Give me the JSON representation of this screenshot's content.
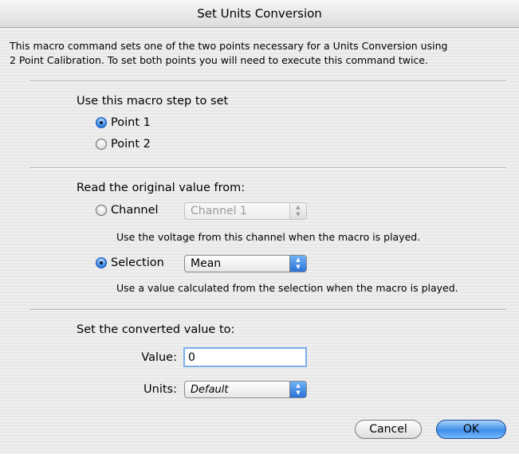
{
  "window": {
    "title": "Set Units Conversion"
  },
  "intro": {
    "line1": "This macro command sets one of the two points necessary for a Units Conversion using",
    "line2": "2 Point Calibration. To set both points you will need to execute this command twice."
  },
  "step": {
    "heading": "Use this macro step to set",
    "point1": "Point 1",
    "point2": "Point 2",
    "selected": "Point 1"
  },
  "source": {
    "heading": "Read the original value from:",
    "channel_label": "Channel",
    "channel_value": "Channel 1",
    "channel_hint": "Use the voltage from this channel when the macro is played.",
    "selection_label": "Selection",
    "selection_value": "Mean",
    "selection_hint": "Use a value calculated from the selection when the macro is played.",
    "selected": "Selection"
  },
  "converted": {
    "heading": "Set the converted value to:",
    "value_label": "Value:",
    "value": "0",
    "units_label": "Units:",
    "units_value": "Default"
  },
  "buttons": {
    "cancel": "Cancel",
    "ok": "OK"
  },
  "colors": {
    "accent": "#3f8ee8",
    "window_bg": "#ececec"
  }
}
